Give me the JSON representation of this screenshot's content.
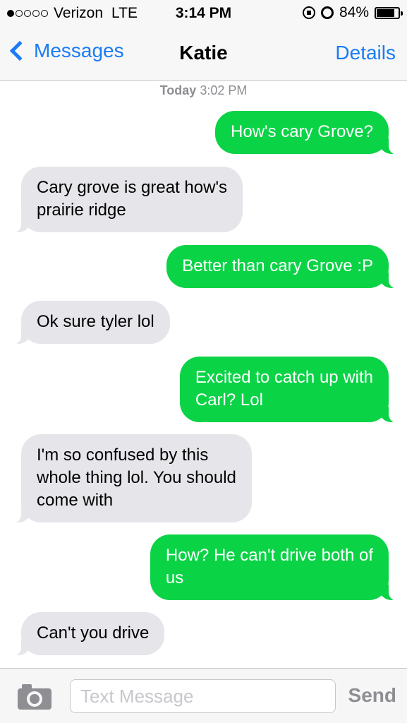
{
  "status_bar": {
    "carrier": "Verizon",
    "network": "LTE",
    "time": "3:14 PM",
    "battery": "84%",
    "battery_level": 0.84,
    "signal_bars": 1,
    "signal_total": 5
  },
  "nav": {
    "back_label": "Messages",
    "title": "Katie",
    "details_label": "Details"
  },
  "timestamp": {
    "day": "Today",
    "time": "3:02 PM"
  },
  "messages": [
    {
      "direction": "out",
      "lines": [
        "How's cary Grove?"
      ]
    },
    {
      "direction": "in",
      "lines": [
        "Cary grove is great how's",
        "prairie ridge"
      ]
    },
    {
      "direction": "out",
      "lines": [
        "Better than cary Grove :P"
      ]
    },
    {
      "direction": "in",
      "lines": [
        "Ok sure tyler lol"
      ]
    },
    {
      "direction": "out",
      "lines": [
        "Excited to catch up with",
        "Carl? Lol"
      ]
    },
    {
      "direction": "in",
      "lines": [
        "I'm so confused by this",
        "whole thing lol. You should",
        "come with"
      ]
    },
    {
      "direction": "out",
      "lines": [
        "How? He can't drive both of",
        "us"
      ]
    },
    {
      "direction": "in",
      "lines": [
        "Can't you drive"
      ]
    }
  ],
  "input": {
    "placeholder": "Text Message",
    "value": "",
    "send_label": "Send"
  },
  "colors": {
    "accent": "#1a7cf4",
    "outgoing_bubble": "#0bd346",
    "incoming_bubble": "#e5e5ea"
  },
  "icons": {
    "back": "chevron-left-icon",
    "camera": "camera-icon",
    "orientation_lock": "orientation-lock-icon",
    "alarm": "alarm-icon",
    "battery": "battery-icon"
  }
}
